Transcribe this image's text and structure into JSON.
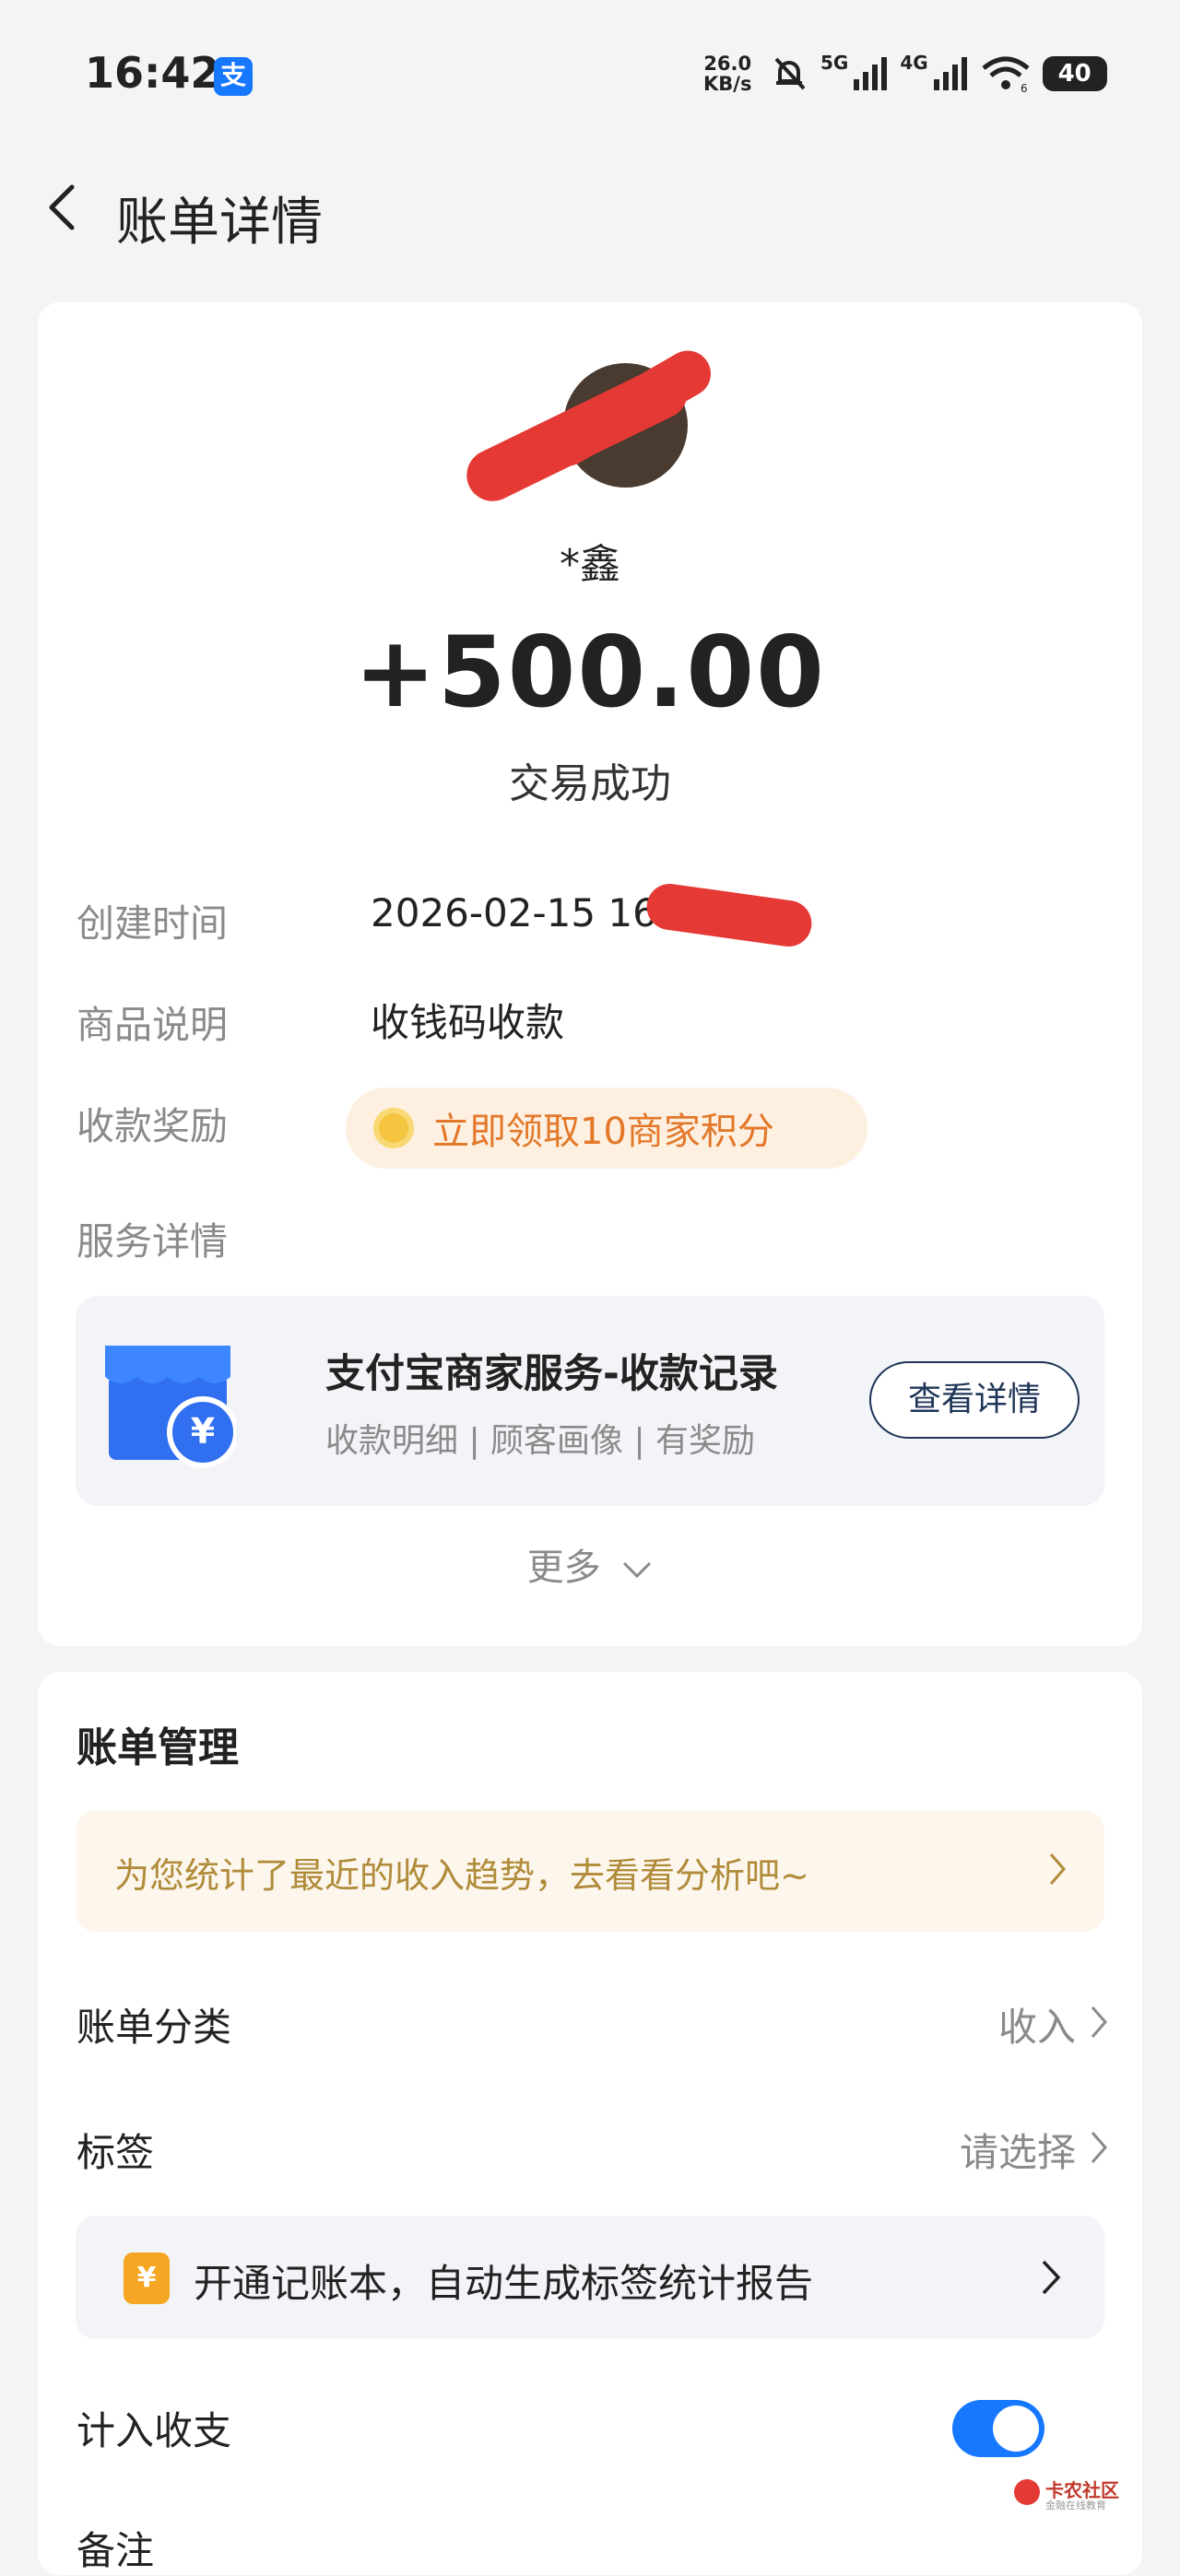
{
  "status_bar": {
    "time": "16:42",
    "app_badge": "支",
    "net_speed_value": "26.0",
    "net_speed_unit": "KB/s",
    "signal_1": "5G",
    "signal_2": "4G",
    "wifi_sub": "6",
    "battery": "40"
  },
  "nav": {
    "title": "账单详情"
  },
  "transaction": {
    "payer_name": "*鑫",
    "amount": "+500.00",
    "status": "交易成功"
  },
  "details": {
    "created_label": "创建时间",
    "created_value": "2026-02-15 16:",
    "goods_label": "商品说明",
    "goods_value": "收钱码收款",
    "reward_label": "收款奖励",
    "reward_value": "立即领取10商家积分",
    "service_label": "服务详情"
  },
  "service": {
    "title": "支付宝商家服务-收款记录",
    "subtitle": "收款明细 | 顾客画像 | 有奖励",
    "button": "查看详情",
    "icon_symbol": "¥"
  },
  "more_label": "更多",
  "bill_management": {
    "title": "账单管理",
    "trend_banner": "为您统计了最近的收入趋势，去看看分析吧~",
    "category_label": "账单分类",
    "category_value": "收入",
    "tag_label": "标签",
    "tag_value": "请选择",
    "ledger_banner": "开通记账本，自动生成标签统计报告",
    "ledger_icon_symbol": "¥",
    "include_label": "计入收支",
    "include_enabled": true,
    "note_label": "备注"
  },
  "watermark": {
    "text": "卡农社区",
    "sub": "金融在线教育"
  },
  "colors": {
    "accent_blue": "#1677ff",
    "reward_orange": "#e3782a",
    "trend_gold": "#b08b3a",
    "redaction_red": "#e53935"
  }
}
